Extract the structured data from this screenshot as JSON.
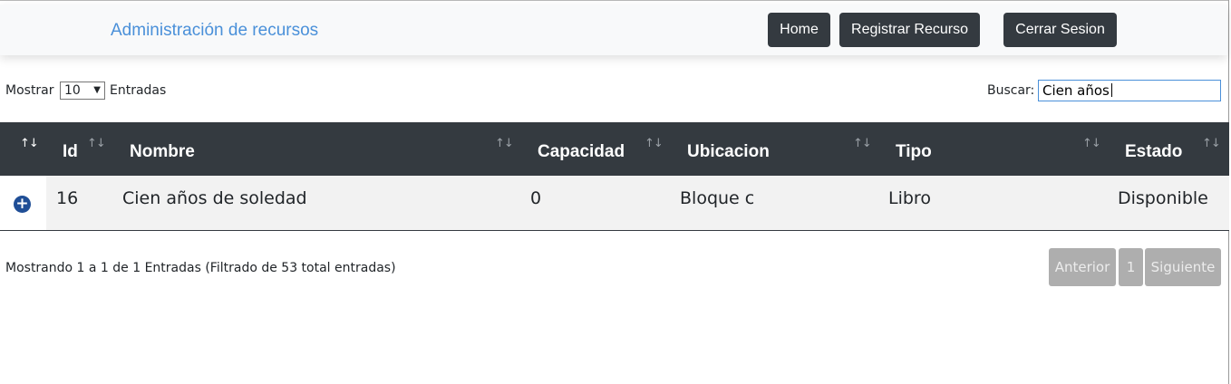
{
  "navbar": {
    "brand": "Administración de recursos",
    "buttons": [
      "Home",
      "Registrar Recurso",
      "Cerrar Sesion"
    ]
  },
  "controls": {
    "show_label": "Mostrar",
    "show_value": "10",
    "entries_label": "Entradas",
    "search_label": "Buscar:",
    "search_value": "Cien años"
  },
  "table": {
    "columns": [
      "",
      "Id",
      "Nombre",
      "Capacidad",
      "Ubicacion",
      "Tipo",
      "Estado"
    ],
    "rows": [
      {
        "id": "16",
        "nombre": "Cien años de soledad",
        "capacidad": "0",
        "ubicacion": "Bloque c",
        "tipo": "Libro",
        "estado": "Disponible"
      }
    ]
  },
  "footer": {
    "info": "Mostrando 1 a 1 de 1 Entradas (Filtrado de 53 total entradas)",
    "pagination": {
      "prev": "Anterior",
      "page": "1",
      "next": "Siguiente"
    }
  },
  "icons": {
    "expand": "plus-circle-icon",
    "sort": "sort-arrows-icon",
    "dropdown": "chevron-down-icon"
  },
  "colors": {
    "header_bg": "#343a40",
    "brand": "#4a90d9",
    "expand": "#1f4e96",
    "pager": "#aeaeae"
  }
}
